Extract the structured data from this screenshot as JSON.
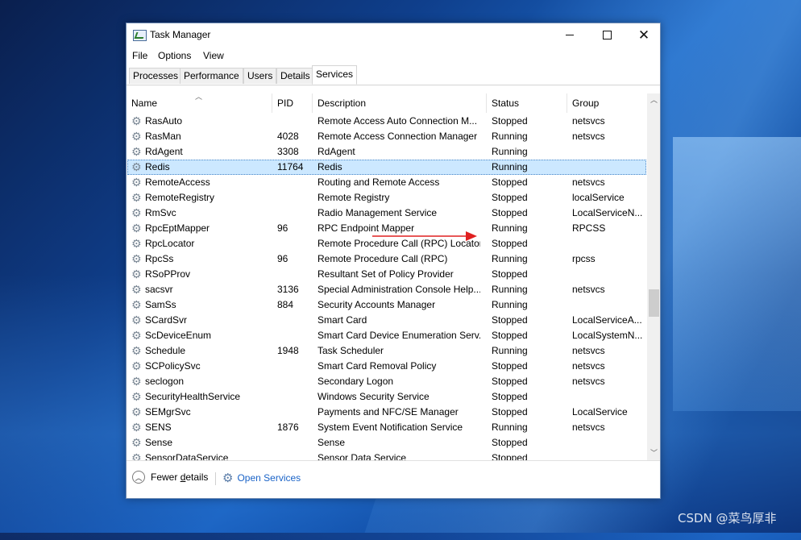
{
  "window": {
    "title": "Task Manager"
  },
  "controls": {
    "minimize": "minimize",
    "maximize": "maximize",
    "close": "✕"
  },
  "menu": [
    "File",
    "Options",
    "View"
  ],
  "tabs": [
    "Processes",
    "Performance",
    "Users",
    "Details",
    "Services"
  ],
  "active_tab": "Services",
  "columns": {
    "name": "Name",
    "pid": "PID",
    "description": "Description",
    "status": "Status",
    "group": "Group"
  },
  "rows": [
    {
      "name": "RasAuto",
      "pid": "",
      "description": "Remote Access Auto Connection M...",
      "status": "Stopped",
      "group": "netsvcs"
    },
    {
      "name": "RasMan",
      "pid": "4028",
      "description": "Remote Access Connection Manager",
      "status": "Running",
      "group": "netsvcs"
    },
    {
      "name": "RdAgent",
      "pid": "3308",
      "description": "RdAgent",
      "status": "Running",
      "group": ""
    },
    {
      "name": "Redis",
      "pid": "11764",
      "description": "Redis",
      "status": "Running",
      "group": "",
      "selected": true
    },
    {
      "name": "RemoteAccess",
      "pid": "",
      "description": "Routing and Remote Access",
      "status": "Stopped",
      "group": "netsvcs"
    },
    {
      "name": "RemoteRegistry",
      "pid": "",
      "description": "Remote Registry",
      "status": "Stopped",
      "group": "localService"
    },
    {
      "name": "RmSvc",
      "pid": "",
      "description": "Radio Management Service",
      "status": "Stopped",
      "group": "LocalServiceN..."
    },
    {
      "name": "RpcEptMapper",
      "pid": "96",
      "description": "RPC Endpoint Mapper",
      "status": "Running",
      "group": "RPCSS"
    },
    {
      "name": "RpcLocator",
      "pid": "",
      "description": "Remote Procedure Call (RPC) Locator",
      "status": "Stopped",
      "group": ""
    },
    {
      "name": "RpcSs",
      "pid": "96",
      "description": "Remote Procedure Call (RPC)",
      "status": "Running",
      "group": "rpcss"
    },
    {
      "name": "RSoPProv",
      "pid": "",
      "description": "Resultant Set of Policy Provider",
      "status": "Stopped",
      "group": ""
    },
    {
      "name": "sacsvr",
      "pid": "3136",
      "description": "Special Administration Console Help...",
      "status": "Running",
      "group": "netsvcs"
    },
    {
      "name": "SamSs",
      "pid": "884",
      "description": "Security Accounts Manager",
      "status": "Running",
      "group": ""
    },
    {
      "name": "SCardSvr",
      "pid": "",
      "description": "Smart Card",
      "status": "Stopped",
      "group": "LocalServiceA..."
    },
    {
      "name": "ScDeviceEnum",
      "pid": "",
      "description": "Smart Card Device Enumeration Serv...",
      "status": "Stopped",
      "group": "LocalSystemN..."
    },
    {
      "name": "Schedule",
      "pid": "1948",
      "description": "Task Scheduler",
      "status": "Running",
      "group": "netsvcs"
    },
    {
      "name": "SCPolicySvc",
      "pid": "",
      "description": "Smart Card Removal Policy",
      "status": "Stopped",
      "group": "netsvcs"
    },
    {
      "name": "seclogon",
      "pid": "",
      "description": "Secondary Logon",
      "status": "Stopped",
      "group": "netsvcs"
    },
    {
      "name": "SecurityHealthService",
      "pid": "",
      "description": "Windows Security Service",
      "status": "Stopped",
      "group": ""
    },
    {
      "name": "SEMgrSvc",
      "pid": "",
      "description": "Payments and NFC/SE Manager",
      "status": "Stopped",
      "group": "LocalService"
    },
    {
      "name": "SENS",
      "pid": "1876",
      "description": "System Event Notification Service",
      "status": "Running",
      "group": "netsvcs"
    },
    {
      "name": "Sense",
      "pid": "",
      "description": "Sense",
      "status": "Stopped",
      "group": ""
    },
    {
      "name": "SensorDataService",
      "pid": "",
      "description": "Sensor Data Service",
      "status": "Stopped",
      "group": ""
    }
  ],
  "footer": {
    "fewer_details_pre": "Fewer ",
    "fewer_details_key": "d",
    "fewer_details_post": "etails",
    "open_services": "Open Services"
  },
  "watermark": "CSDN @菜鸟厚非",
  "icons": {
    "row": "gear-icon",
    "app": "task-manager-icon",
    "open_services": "services-gear-icon",
    "fewer": "chevron-up-circle-icon"
  },
  "colors": {
    "selection": "#cce8ff",
    "link": "#1a63c7",
    "annotation_arrow": "#e02020"
  }
}
